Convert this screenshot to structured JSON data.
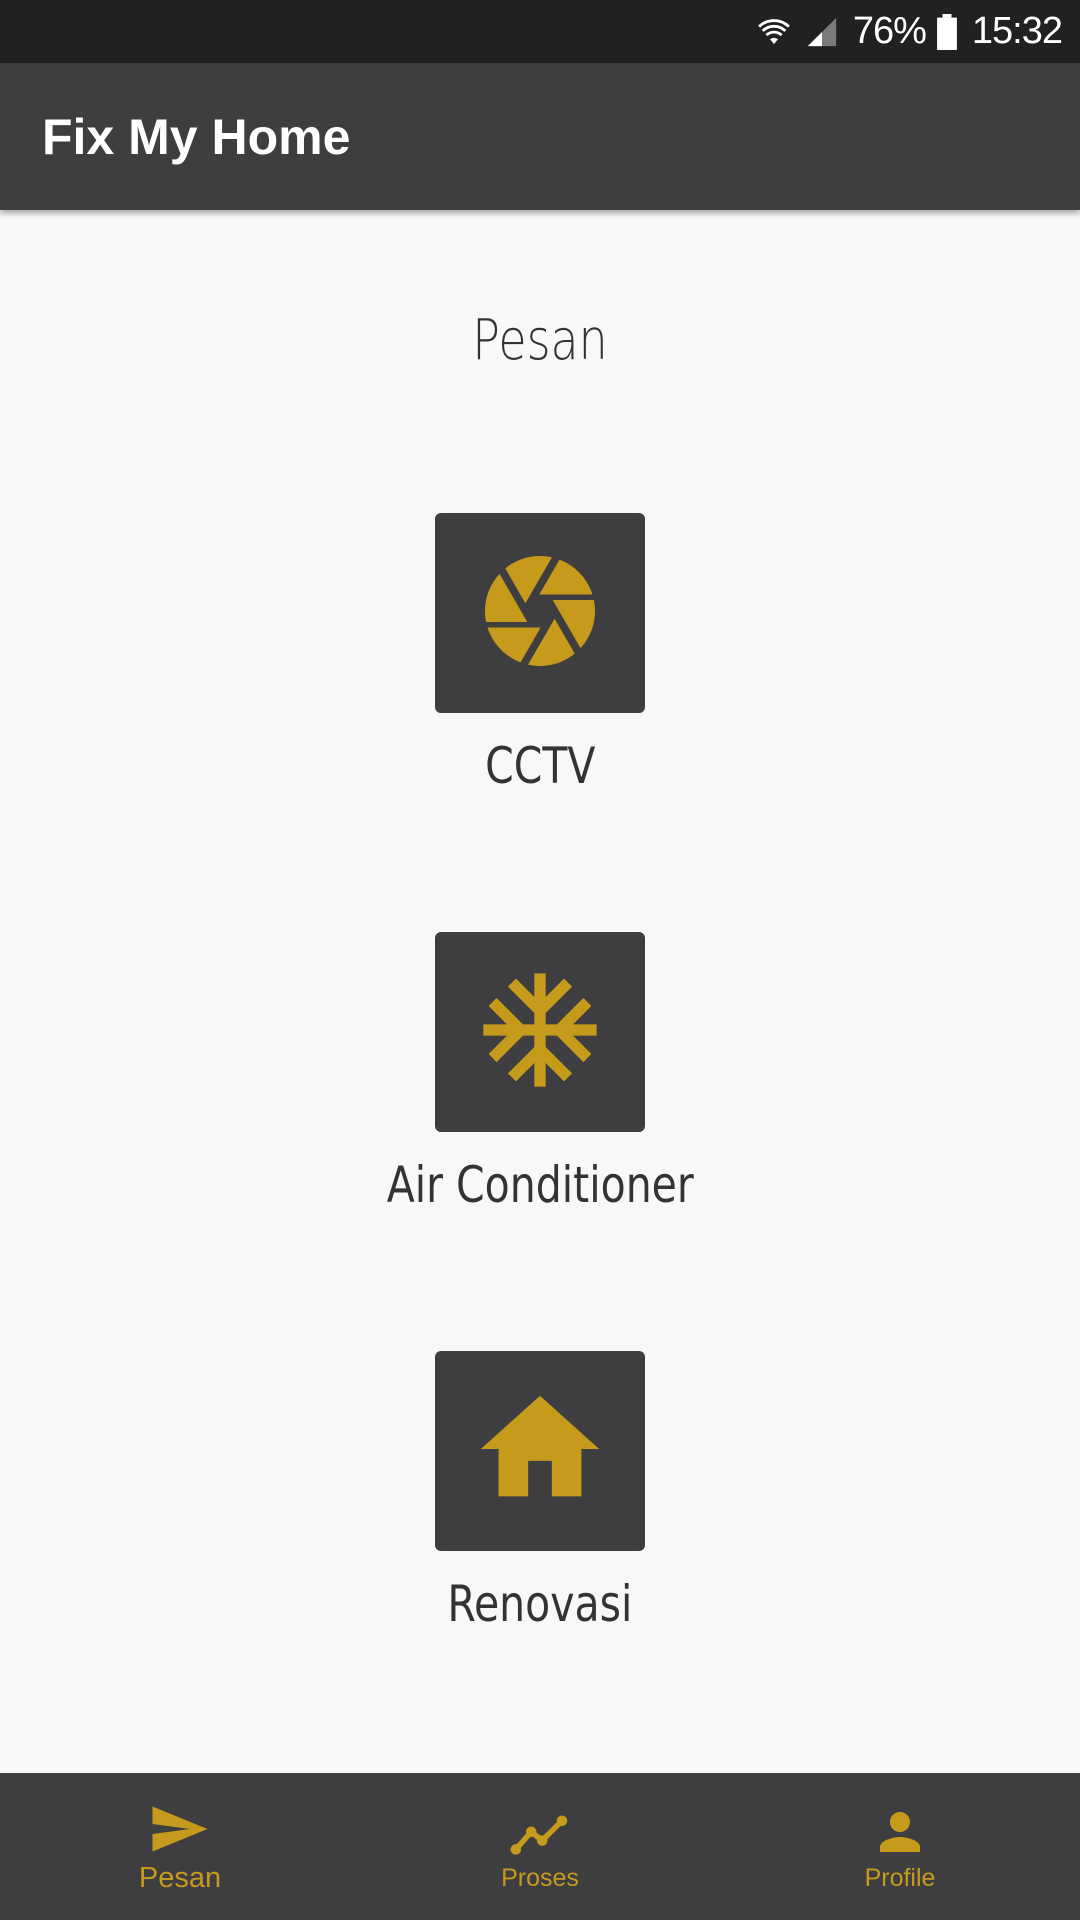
{
  "status_bar": {
    "battery_percent": "76%",
    "time": "15:32",
    "icons": [
      "wifi-icon",
      "signal-icon",
      "battery-icon"
    ]
  },
  "app_bar": {
    "title": "Fix My Home"
  },
  "main": {
    "heading": "Pesan",
    "services": [
      {
        "label": "CCTV",
        "icon": "camera-shutter-icon"
      },
      {
        "label": "Air Conditioner",
        "icon": "snowflake-icon"
      },
      {
        "label": "Renovasi",
        "icon": "house-icon"
      }
    ]
  },
  "bottom_nav": {
    "items": [
      {
        "label": "Pesan",
        "icon": "send-icon",
        "active": true
      },
      {
        "label": "Proses",
        "icon": "trending-icon",
        "active": false
      },
      {
        "label": "Profile",
        "icon": "person-icon",
        "active": false
      }
    ]
  },
  "colors": {
    "accent": "#c69a1b",
    "bar": "#3e3e41",
    "status_bar": "#212121",
    "background": "#f8f8f8"
  }
}
